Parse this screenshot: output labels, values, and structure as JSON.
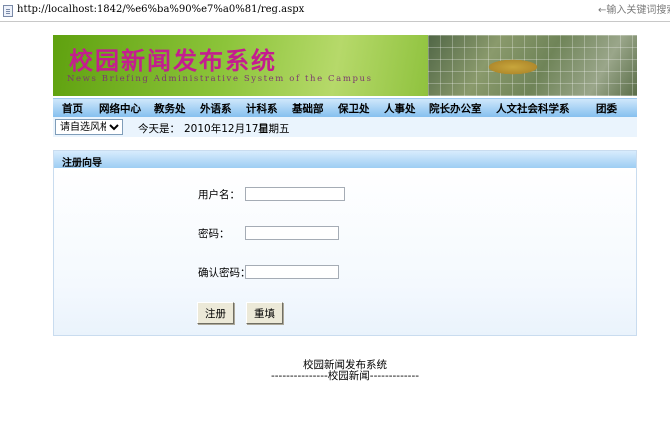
{
  "browser": {
    "url": "http://localhost:1842/%e6%ba%90%e7%a0%81/reg.aspx",
    "search_placeholder": "←输入关键词搜索"
  },
  "banner": {
    "title": "校园新闻发布系统",
    "subtitle": "News Briefing Administrative System of the Campus",
    "photo_icon": "campus-photo"
  },
  "nav": {
    "items": [
      {
        "label": "首页"
      },
      {
        "label": "网络中心"
      },
      {
        "label": "教务处"
      },
      {
        "label": "外语系"
      },
      {
        "label": "计科系"
      },
      {
        "label": "基础部"
      },
      {
        "label": "保卫处"
      },
      {
        "label": "人事处"
      },
      {
        "label": "院长办公室"
      },
      {
        "label": "人文社会科学系"
      },
      {
        "label": "团委"
      }
    ]
  },
  "toolbar": {
    "style_select_value": "请自选风格",
    "today_label": "今天是：",
    "date": "2010年12月17日",
    "weekday": "星期五"
  },
  "register": {
    "title": "注册向导",
    "username_label": "用户名：",
    "password_label": "密码：",
    "confirm_label": "确认密码：",
    "submit_label": "注册",
    "reset_label": "重填"
  },
  "footer": {
    "line1": "校园新闻发布系统",
    "line2": "---------------校园新闻-------------"
  },
  "colors": {
    "nav_bar": "#86c0ef",
    "banner_green": "#8cc43a",
    "banner_title": "#c41d8f",
    "panel_header": "#9dcdf3"
  }
}
